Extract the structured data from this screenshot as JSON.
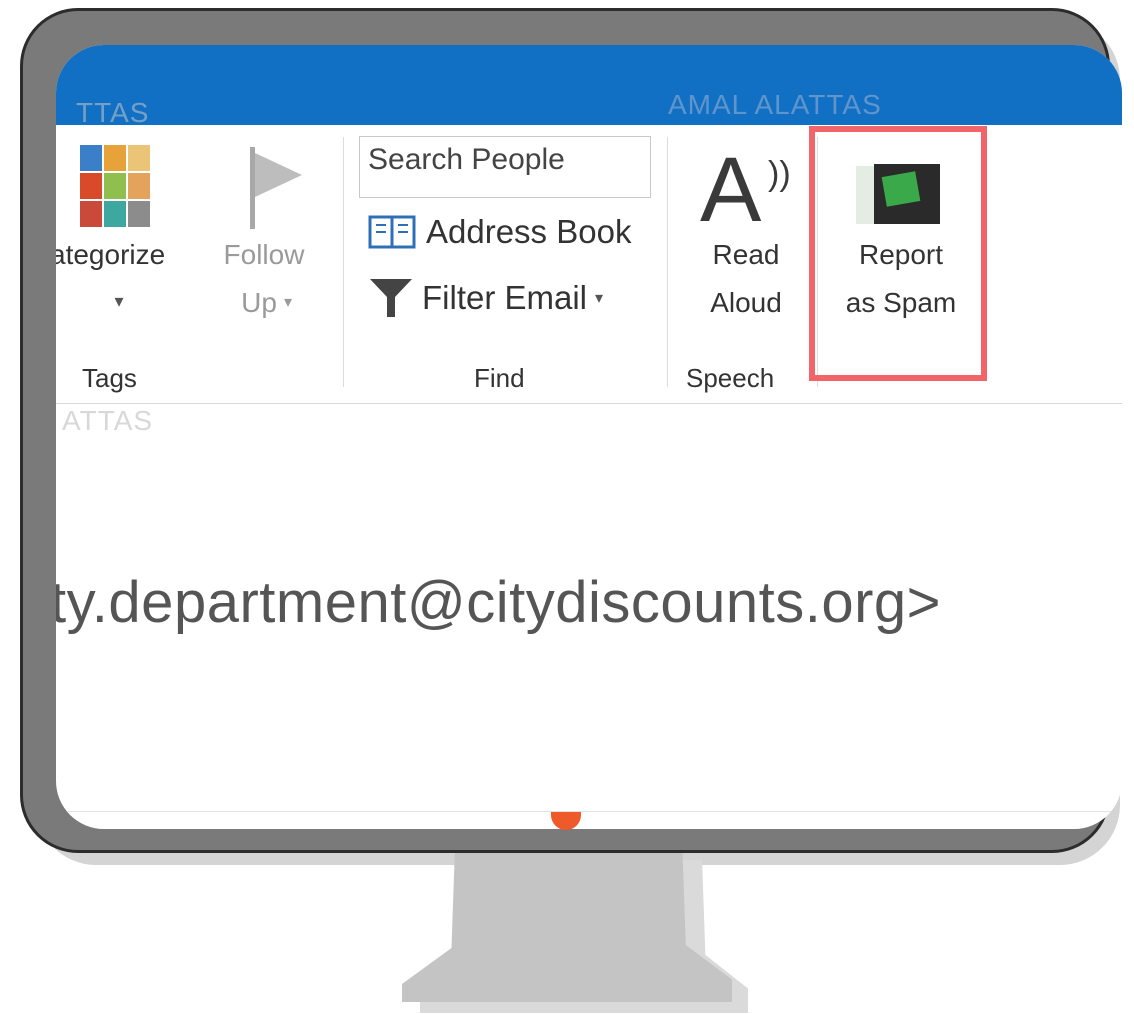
{
  "watermark": {
    "user": "AMAL ALATTAS",
    "left_top": "TTAS",
    "left_mid": "ATTAS"
  },
  "ribbon": {
    "tags_group": {
      "label": "Tags",
      "categorize_label": "ategorize",
      "categorize_arrow": "▾",
      "follow_label_1": "Follow",
      "follow_label_2": "Up",
      "follow_arrow": "▾"
    },
    "find_group": {
      "label": "Find",
      "search_placeholder": "Search People",
      "address_book_label": "Address Book",
      "filter_email_label": "Filter Email",
      "filter_arrow": "▾"
    },
    "speech_group": {
      "label": "Speech",
      "read_aloud_line1": "Read",
      "read_aloud_line2": "Aloud",
      "read_icon_letter": "A",
      "read_icon_waves": "))"
    },
    "spam": {
      "label_line1": "Report",
      "label_line2": "as Spam"
    }
  },
  "email": {
    "sender_address": "ty.department@citydiscounts.org>"
  },
  "colors": {
    "title_bar": "#1170c4",
    "highlight": "#f0646a",
    "monitor_frame": "#7a7a7a",
    "stand": "#c4c4c4"
  },
  "icons": {
    "categorize": "categorize-grid-icon",
    "follow_up": "flag-icon",
    "address_book": "address-book-icon",
    "filter": "filter-funnel-icon",
    "read_aloud": "read-aloud-icon",
    "spam": "report-spam-icon"
  }
}
